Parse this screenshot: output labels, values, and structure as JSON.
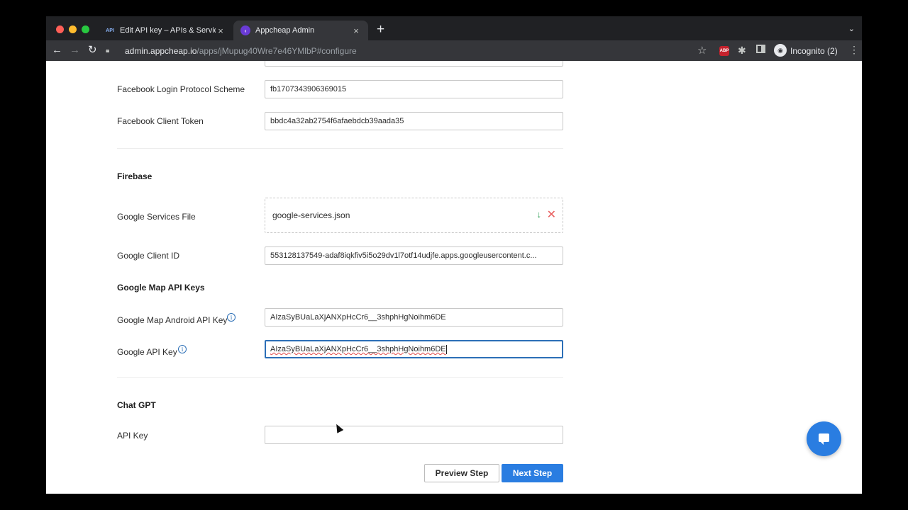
{
  "browser": {
    "tabs": [
      {
        "favicon": "API",
        "title": "Edit API key – APIs & Services"
      },
      {
        "favicon": "appcheap-logo-icon",
        "title": "Appcheap Admin"
      }
    ],
    "url_host": "admin.appcheap.io",
    "url_path": "/apps/jMupug40Wre7e46YMlbP#configure",
    "incognito_label": "Incognito (2)",
    "ext_abp": "ABP"
  },
  "form": {
    "facebook_protocol_label": "Facebook Login Protocol Scheme",
    "facebook_protocol_value": "fb1707343906369015",
    "facebook_token_label": "Facebook Client Token",
    "facebook_token_value": "bbdc4a32ab2754f6afaebdcb39aada35",
    "firebase_heading": "Firebase",
    "services_file_label": "Google Services File",
    "services_file_name": "google-services.json",
    "client_id_label": "Google Client ID",
    "client_id_value": "553128137549-adaf8iqkfiv5i5o29dv1l7otf14udjfe.apps.googleusercontent.c...",
    "maps_heading": "Google Map API Keys",
    "android_key_label": "Google Map Android API Key",
    "android_key_value": "AIzaSyBUaLaXjANXpHcCr6__3shphHgNoihm6DE",
    "api_key_label": "Google API Key",
    "api_key_value": "AIzaSyBUaLaXjANXpHcCr6__3shphHgNoihm6DE",
    "chatgpt_heading": "Chat GPT",
    "chatgpt_key_label": "API Key",
    "chatgpt_key_value": ""
  },
  "buttons": {
    "preview": "Preview Step",
    "next": "Next Step"
  },
  "colors": {
    "primary": "#2a7de1",
    "focus": "#2c6fb7",
    "success": "#2e9e55",
    "danger": "#e85c5c"
  }
}
